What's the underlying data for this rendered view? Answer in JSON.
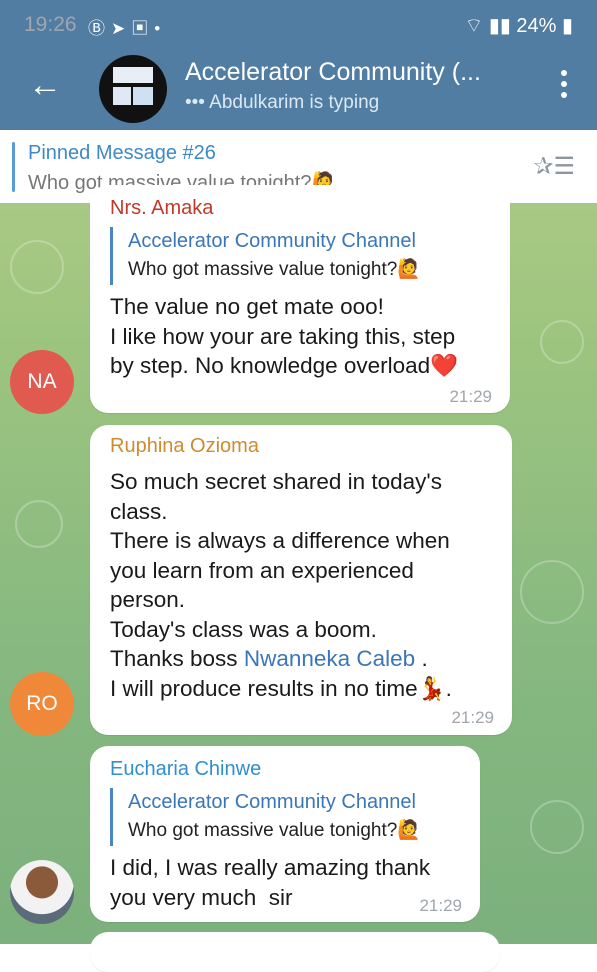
{
  "status": {
    "time": "19:26",
    "battery": "24%",
    "icons_left": [
      "b-icon",
      "telegram-icon",
      "gallery-icon",
      "dot-icon"
    ]
  },
  "header": {
    "title": "Accelerator Community (...",
    "subtitle": "••• Abdulkarim is typing"
  },
  "pinned": {
    "title": "Pinned Message #26",
    "text": "Who got massive value tonight?🙋"
  },
  "messages": [
    {
      "sender": "Nrs. Amaka",
      "reply_title": "Accelerator Community Channel",
      "reply_text": "Who got massive value tonight?🙋",
      "text": "The value no get mate ooo!\nI like how your are taking this, step\nby step. No knowledge overload❤️",
      "time": "21:29",
      "avatar_initials": "NA"
    },
    {
      "sender": "Ruphina Ozioma",
      "text_part1": "So much secret shared in today's\nclass.\nThere is always a difference when\nyou learn from an experienced\nperson.\nToday's class was a boom.\nThanks boss ",
      "mention": "Nwanneka Caleb",
      "text_part2": " .\nI will produce results in no time💃.",
      "time": "21:29",
      "avatar_initials": "RO"
    },
    {
      "sender": "Eucharia Chinwe",
      "reply_title": "Accelerator Community Channel",
      "reply_text": "Who got massive value tonight?🙋",
      "text": "I did, I was really amazing thank\nyou very much  sir",
      "time": "21:29"
    }
  ],
  "colors": {
    "header": "#517da2",
    "name1": "#c0392b",
    "name2": "#d08a2f",
    "name3": "#2f8fcf",
    "na_avatar": "#e05a4f",
    "ro_avatar": "#f0883a"
  }
}
